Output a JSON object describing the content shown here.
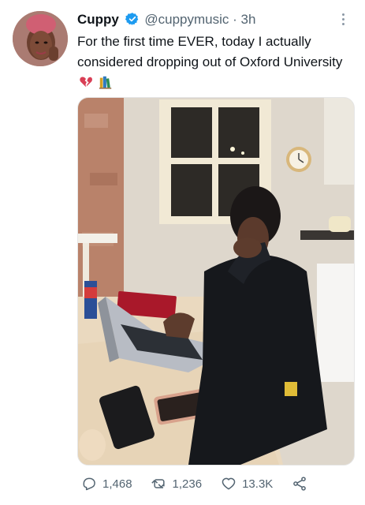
{
  "tweet": {
    "author_name": "Cuppy",
    "handle": "@cuppymusic",
    "separator": "·",
    "time": "3h",
    "text": "For the first time EVER, today I actually considered dropping out of Oxford University",
    "emojis": [
      "broken-heart-icon",
      "books-icon"
    ],
    "verified": true
  },
  "actions": {
    "reply_count": "1,468",
    "retweet_count": "1,236",
    "like_count": "13.3K"
  },
  "icons": {
    "avatar": "avatar",
    "verified": "verified-badge-icon",
    "more": "more-options-icon",
    "reply": "reply-icon",
    "retweet": "retweet-icon",
    "like": "heart-icon",
    "share": "share-icon"
  },
  "colors": {
    "accent": "#1d9bf0",
    "text": "#0f1419",
    "secondary": "#536471"
  }
}
